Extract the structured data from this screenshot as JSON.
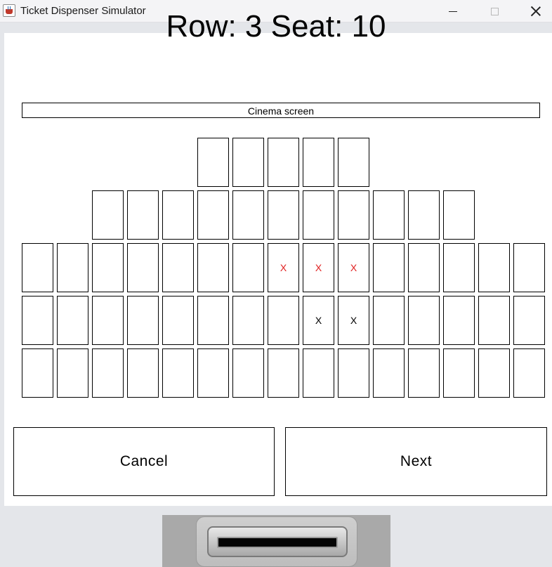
{
  "window": {
    "title": "Ticket Dispenser Simulator",
    "icon": "java-cup-icon",
    "controls": [
      "minimize-icon",
      "maximize-icon",
      "close-icon"
    ]
  },
  "selection_text": "Row: 3 Seat: 10",
  "screen_label": "Cinema screen",
  "seating": {
    "rows": [
      {
        "row": 1,
        "seats": [
          "",
          "",
          "",
          "",
          ""
        ]
      },
      {
        "row": 2,
        "seats": [
          "",
          "",
          "",
          "",
          "",
          "",
          "",
          "",
          "",
          "",
          ""
        ]
      },
      {
        "row": 3,
        "seats": [
          "",
          "",
          "",
          "",
          "",
          "",
          "",
          "X",
          "X",
          "X",
          "",
          "",
          "",
          "",
          ""
        ],
        "states": [
          "free",
          "free",
          "free",
          "free",
          "free",
          "free",
          "free",
          "selected",
          "selected",
          "selected",
          "free",
          "free",
          "free",
          "free",
          "free"
        ]
      },
      {
        "row": 4,
        "seats": [
          "",
          "",
          "",
          "",
          "",
          "",
          "",
          "",
          "X",
          "X",
          "",
          "",
          "",
          "",
          ""
        ],
        "states": [
          "free",
          "free",
          "free",
          "free",
          "free",
          "free",
          "free",
          "free",
          "taken",
          "taken",
          "free",
          "free",
          "free",
          "free",
          "free"
        ]
      },
      {
        "row": 5,
        "seats": [
          "",
          "",
          "",
          "",
          "",
          "",
          "",
          "",
          "",
          "",
          "",
          "",
          "",
          "",
          ""
        ]
      }
    ],
    "colors": {
      "selected": "#e02020",
      "taken": "#000000"
    }
  },
  "buttons": {
    "cancel": "Cancel",
    "next": "Next"
  },
  "dispenser": {
    "icon": "ticket-slot-icon"
  }
}
